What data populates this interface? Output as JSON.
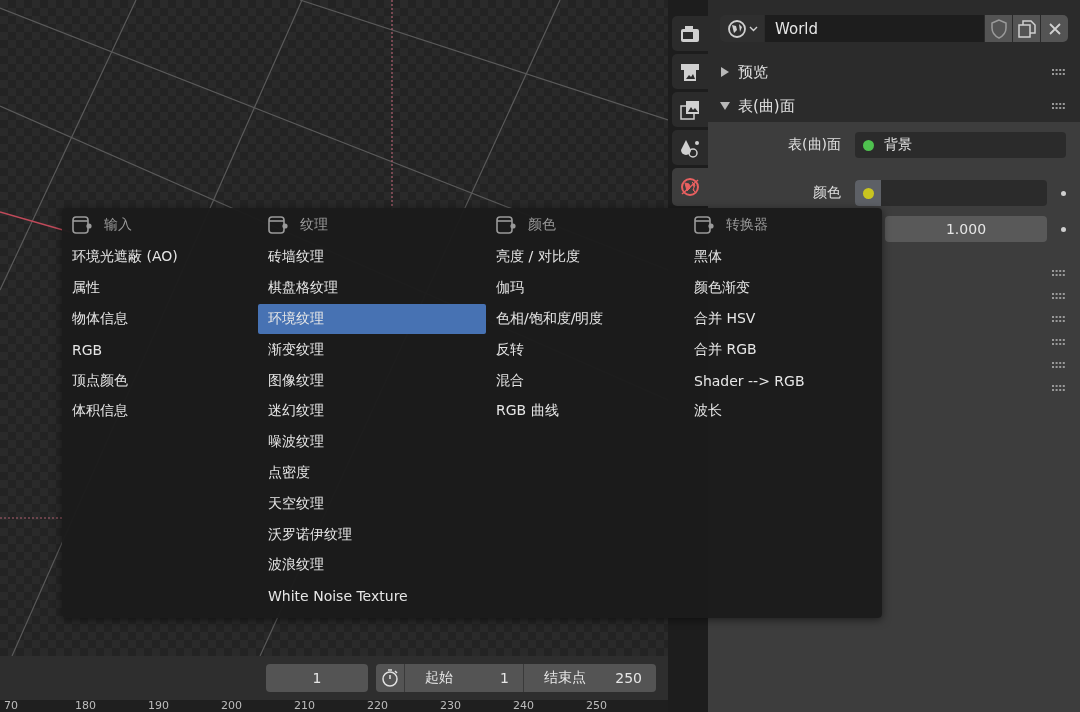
{
  "tabs": [
    {
      "kind": "render",
      "selected": false
    },
    {
      "kind": "output",
      "selected": false
    },
    {
      "kind": "view-layer",
      "selected": false
    },
    {
      "kind": "scene",
      "selected": false
    },
    {
      "kind": "world",
      "selected": true
    }
  ],
  "world_selector": {
    "name": "World"
  },
  "panels": [
    {
      "title": "预览",
      "expanded": false
    },
    {
      "title": "表(曲)面",
      "expanded": true
    }
  ],
  "properties": [
    {
      "kind": "shader",
      "label": "表(曲)面",
      "value": "背景"
    },
    {
      "kind": "color",
      "label": "颜色"
    },
    {
      "kind": "number",
      "value": "1.000"
    }
  ],
  "menu": {
    "columns": [
      {
        "title": "输入",
        "items": [
          {
            "label": "环境光遮蔽 (AO)",
            "selected": false
          },
          {
            "label": "属性",
            "selected": false
          },
          {
            "label": "物体信息",
            "selected": false
          },
          {
            "label": "RGB",
            "selected": false
          },
          {
            "label": "顶点颜色",
            "selected": false
          },
          {
            "label": "体积信息",
            "selected": false
          }
        ]
      },
      {
        "title": "纹理",
        "items": [
          {
            "label": "砖墙纹理",
            "selected": false
          },
          {
            "label": "棋盘格纹理",
            "selected": false
          },
          {
            "label": "环境纹理",
            "selected": true
          },
          {
            "label": "渐变纹理",
            "selected": false
          },
          {
            "label": "图像纹理",
            "selected": false
          },
          {
            "label": "迷幻纹理",
            "selected": false
          },
          {
            "label": "噪波纹理",
            "selected": false
          },
          {
            "label": "点密度",
            "selected": false
          },
          {
            "label": "天空纹理",
            "selected": false
          },
          {
            "label": "沃罗诺伊纹理",
            "selected": false
          },
          {
            "label": "波浪纹理",
            "selected": false
          },
          {
            "label": "White Noise Texture",
            "selected": false
          }
        ]
      },
      {
        "title": "颜色",
        "items": [
          {
            "label": "亮度 / 对比度",
            "selected": false
          },
          {
            "label": "伽玛",
            "selected": false
          },
          {
            "label": "色相/饱和度/明度",
            "selected": false
          },
          {
            "label": "反转",
            "selected": false
          },
          {
            "label": "混合",
            "selected": false
          },
          {
            "label": "RGB 曲线",
            "selected": false
          }
        ]
      },
      {
        "title": "转换器",
        "items": [
          {
            "label": "黑体",
            "selected": false
          },
          {
            "label": "颜色渐变",
            "selected": false
          },
          {
            "label": "合并 HSV",
            "selected": false
          },
          {
            "label": "合并 RGB",
            "selected": false
          },
          {
            "label": "Shader --> RGB",
            "selected": false
          },
          {
            "label": "波长",
            "selected": false
          }
        ]
      }
    ]
  },
  "timeline": {
    "current_frame": "1",
    "start_label": "起始",
    "start": "1",
    "end_label": "结束点",
    "end": "250"
  },
  "ruler": [
    "70",
    "180",
    "190",
    "200",
    "210",
    "220",
    "230",
    "240",
    "250"
  ]
}
